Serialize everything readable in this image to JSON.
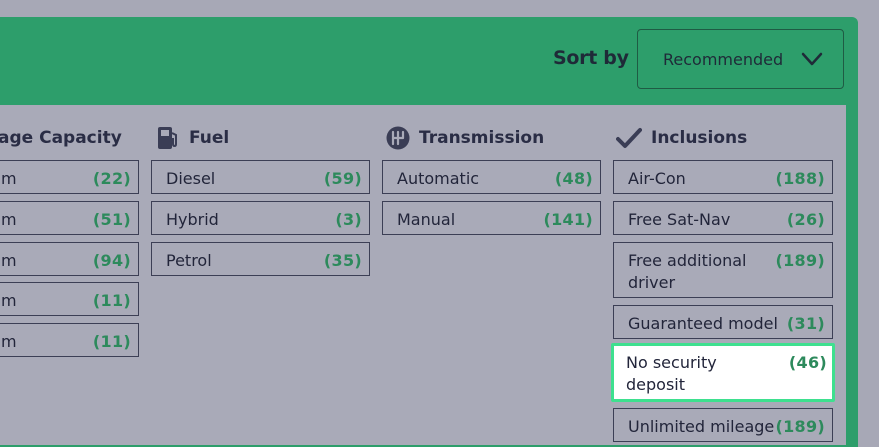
{
  "sort": {
    "label": "Sort by",
    "selected": "Recommended"
  },
  "columns": {
    "luggage": {
      "title": "Luggage Capacity",
      "title_visible": "age Capacity",
      "options": [
        {
          "label": "m",
          "count": "(22)"
        },
        {
          "label": "m",
          "count": "(51)"
        },
        {
          "label": "m",
          "count": "(94)"
        },
        {
          "label": "m",
          "count": "(11)"
        },
        {
          "label": "m",
          "count": "(11)"
        }
      ]
    },
    "fuel": {
      "title": "Fuel",
      "icon": "fuel-pump-icon",
      "options": [
        {
          "label": "Diesel",
          "count": "(59)"
        },
        {
          "label": "Hybrid",
          "count": "(3)"
        },
        {
          "label": "Petrol",
          "count": "(35)"
        }
      ]
    },
    "transmission": {
      "title": "Transmission",
      "icon": "gearshift-icon",
      "options": [
        {
          "label": "Automatic",
          "count": "(48)"
        },
        {
          "label": "Manual",
          "count": "(141)"
        }
      ]
    },
    "inclusions": {
      "title": "Inclusions",
      "icon": "checkmark-icon",
      "options": [
        {
          "label": "Air-Con",
          "count": "(188)"
        },
        {
          "label": "Free Sat-Nav",
          "count": "(26)"
        },
        {
          "label": "Free additional driver",
          "count": "(189)"
        },
        {
          "label": "Guaranteed model",
          "count": "(31)"
        },
        {
          "label": "No security deposit",
          "count": "(46)",
          "selected": true
        },
        {
          "label": "Unlimited mileage",
          "count": "(189)"
        }
      ]
    }
  },
  "colors": {
    "accent": "#2d9e6b",
    "count": "#2d8a5c",
    "highlight": "#3ee08f",
    "panel": "#a9aab8"
  }
}
